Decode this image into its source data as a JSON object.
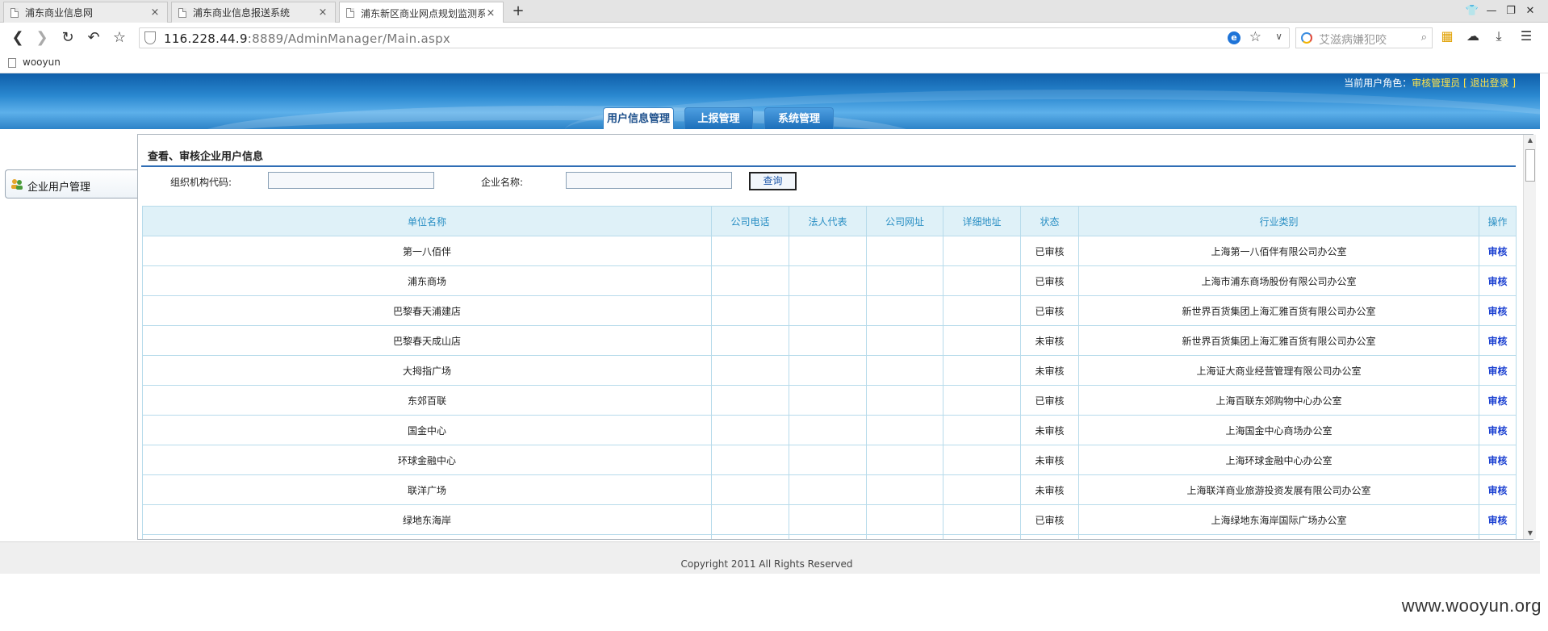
{
  "browser": {
    "tabs": [
      {
        "title": "浦东商业信息网",
        "close": "×"
      },
      {
        "title": "浦东商业信息报送系统",
        "close": "×"
      },
      {
        "title": "浦东新区商业网点规划监测系",
        "close": "×"
      }
    ],
    "new_tab": "+",
    "url_host": "116.228.44.9",
    "url_path": ":8889/AdminManager/Main.aspx",
    "search_placeholder": "艾滋病嫌犯咬",
    "bookmark": "wooyun",
    "ie_badge": "e"
  },
  "header": {
    "role_prefix": "当前用户角色：",
    "role": "审核管理员",
    "bracket_open": "[",
    "logout": "退出登录",
    "bracket_close": "]",
    "menu": [
      {
        "label": "用户信息管理",
        "active": true
      },
      {
        "label": "上报管理",
        "active": false
      },
      {
        "label": "系统管理",
        "active": false
      }
    ]
  },
  "sidebar": {
    "item": "企业用户管理"
  },
  "panel": {
    "title": "查看、审核企业用户信息",
    "org_code_label": "组织机构代码:",
    "org_code_value": "",
    "company_label": "企业名称:",
    "company_value": "",
    "query_button": "查询"
  },
  "table": {
    "headers": [
      "单位名称",
      "公司电话",
      "法人代表",
      "公司网址",
      "详细地址",
      "状态",
      "行业类别",
      "操作"
    ],
    "rows": [
      [
        "第一八佰伴",
        "",
        "",
        "",
        "",
        "已审核",
        "上海第一八佰伴有限公司办公室",
        "审核"
      ],
      [
        "浦东商场",
        "",
        "",
        "",
        "",
        "已审核",
        "上海市浦东商场股份有限公司办公室",
        "审核"
      ],
      [
        "巴黎春天浦建店",
        "",
        "",
        "",
        "",
        "已审核",
        "新世界百货集团上海汇雅百货有限公司办公室",
        "审核"
      ],
      [
        "巴黎春天成山店",
        "",
        "",
        "",
        "",
        "未审核",
        "新世界百货集团上海汇雅百货有限公司办公室",
        "审核"
      ],
      [
        "大拇指广场",
        "",
        "",
        "",
        "",
        "未审核",
        "上海证大商业经营管理有限公司办公室",
        "审核"
      ],
      [
        "东郊百联",
        "",
        "",
        "",
        "",
        "已审核",
        "上海百联东郊购物中心办公室",
        "审核"
      ],
      [
        "国金中心",
        "",
        "",
        "",
        "",
        "未审核",
        "上海国金中心商场办公室",
        "审核"
      ],
      [
        "环球金融中心",
        "",
        "",
        "",
        "",
        "未审核",
        "上海环球金融中心办公室",
        "审核"
      ],
      [
        "联洋广场",
        "",
        "",
        "",
        "",
        "未审核",
        "上海联洋商业旅游投资发展有限公司办公室",
        "审核"
      ],
      [
        "绿地东海岸",
        "",
        "",
        "",
        "",
        "已审核",
        "上海绿地东海岸国际广场办公室",
        "审核"
      ],
      [
        "",
        "",
        "",
        "",
        "",
        "",
        "",
        ""
      ]
    ]
  },
  "footer": {
    "copyright": "Copyright 2011  All Rights Reserved"
  },
  "watermark": "www.wooyun.org",
  "colors": {
    "banner": "#2a88d0",
    "table_header_bg": "#dff1f8",
    "table_header_text": "#2a8fc4",
    "action_link": "#1a3fd1",
    "role_text": "#ffe44a"
  }
}
